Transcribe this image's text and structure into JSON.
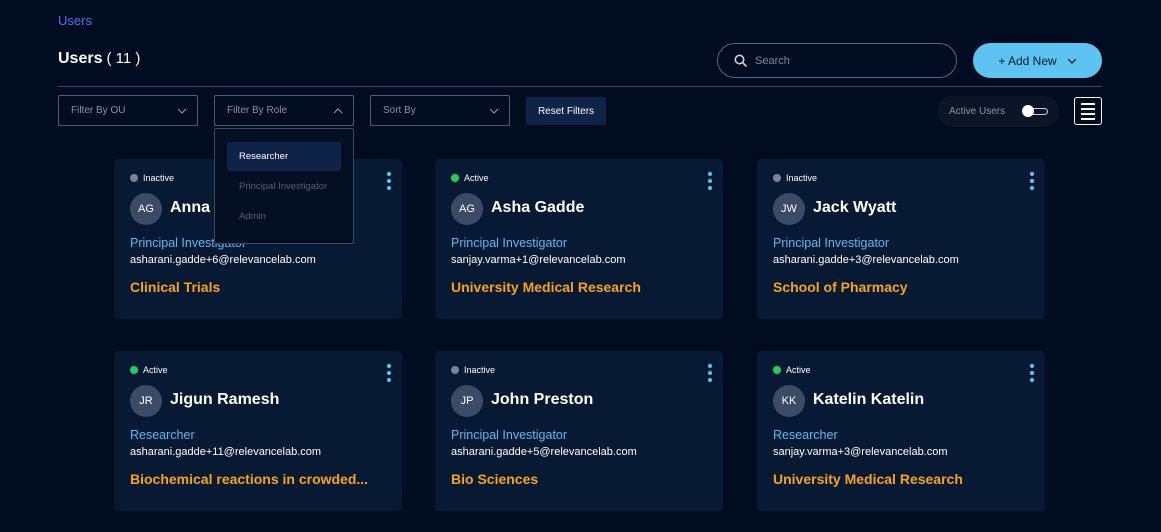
{
  "breadcrumb": "Users",
  "header": {
    "title": "Users",
    "count": "( 11 )"
  },
  "search": {
    "placeholder": "Search"
  },
  "add_new": {
    "label": "+ Add New"
  },
  "filters": {
    "ou": "Filter By OU",
    "role": "Filter By Role",
    "sort": "Sort By",
    "reset": "Reset Filters",
    "active_users": "Active Users",
    "active_users_on": false
  },
  "role_dropdown": {
    "options": [
      "Researcher",
      "Principal Investigator",
      "Admin"
    ],
    "selected": "Researcher"
  },
  "colors": {
    "active": "#1fce5f",
    "inactive": "#7b8494",
    "accent": "#5cc3f2",
    "org": "#f7a21b"
  },
  "users": [
    {
      "status": "Inactive",
      "initials": "AG",
      "name": "Anna",
      "role": "Principal Investigator",
      "email": "asharani.gadde+6@relevancelab.com",
      "org": "Clinical Trials"
    },
    {
      "status": "Active",
      "initials": "AG",
      "name": "Asha Gadde",
      "role": "Principal Investigator",
      "email": "sanjay.varma+1@relevancelab.com",
      "org": "University Medical Research"
    },
    {
      "status": "Inactive",
      "initials": "JW",
      "name": "Jack Wyatt",
      "role": "Principal Investigator",
      "email": "asharani.gadde+3@relevancelab.com",
      "org": "School of Pharmacy"
    },
    {
      "status": "Active",
      "initials": "JR",
      "name": "Jigun Ramesh",
      "role": "Researcher",
      "email": "asharani.gadde+11@relevancelab.com",
      "org": "Biochemical reactions in crowded..."
    },
    {
      "status": "Inactive",
      "initials": "JP",
      "name": "John Preston",
      "role": "Principal Investigator",
      "email": "asharani.gadde+5@relevancelab.com",
      "org": "Bio Sciences"
    },
    {
      "status": "Active",
      "initials": "KK",
      "name": "Katelin Katelin",
      "role": "Researcher",
      "email": "sanjay.varma+3@relevancelab.com",
      "org": "University Medical Research"
    }
  ]
}
